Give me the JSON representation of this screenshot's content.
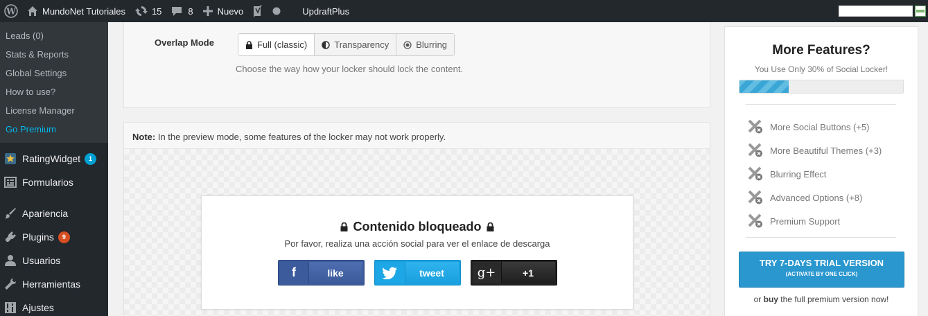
{
  "adminbar": {
    "site_name": "MundoNet Tutoriales",
    "updates_count": "15",
    "comments_count": "8",
    "new_label": "Nuevo",
    "plugin_label": "UpdraftPlus"
  },
  "sidebar": {
    "submenu": [
      {
        "label": "Leads (0)"
      },
      {
        "label": "Stats & Reports"
      },
      {
        "label": "Global Settings"
      },
      {
        "label": "How to use?"
      },
      {
        "label": "License Manager"
      },
      {
        "label": "Go Premium"
      }
    ],
    "menu": [
      {
        "label": "RatingWidget",
        "badge": "1"
      },
      {
        "label": "Formularios"
      },
      {
        "label": "Apariencia"
      },
      {
        "label": "Plugins",
        "badge": "9"
      },
      {
        "label": "Usuarios"
      },
      {
        "label": "Herramientas"
      },
      {
        "label": "Ajustes"
      }
    ]
  },
  "overlap": {
    "label": "Overlap Mode",
    "options": [
      "Full (classic)",
      "Transparency",
      "Blurring"
    ],
    "selected": "Full (classic)",
    "hint": "Choose the way how your locker should lock the content."
  },
  "preview": {
    "note_label": "Note:",
    "note_text": " In the preview mode, some features of the locker may not work properly.",
    "locker_title": "Contenido bloqueado",
    "locker_sub": "Por favor, realiza una acción social para ver el enlace de descarga",
    "buttons": {
      "facebook": {
        "icon": "f",
        "label": "like"
      },
      "twitter": {
        "label": "tweet"
      },
      "google": {
        "icon": "g+",
        "label": "+1"
      }
    }
  },
  "features": {
    "title": "More Features?",
    "subtitle": "You Use Only 30% of Social Locker!",
    "progress": 0.3,
    "items": [
      "More Social Buttons (+5)",
      "More Beautiful Themes (+3)",
      "Blurring Effect",
      "Advanced Options (+8)",
      "Premium Support"
    ],
    "cta_main": "TRY 7-DAYS TRIAL VERSION",
    "cta_small": "(ACTIVATE BY ONE CLICK)",
    "footer_pre": "or ",
    "footer_bold": "buy",
    "footer_post": " the full premium version now!",
    "accent": "#2a97cf"
  },
  "colors": {
    "adminbar": "#23282d",
    "submenu_bg": "#32373c",
    "active_link": "#00b9eb"
  }
}
